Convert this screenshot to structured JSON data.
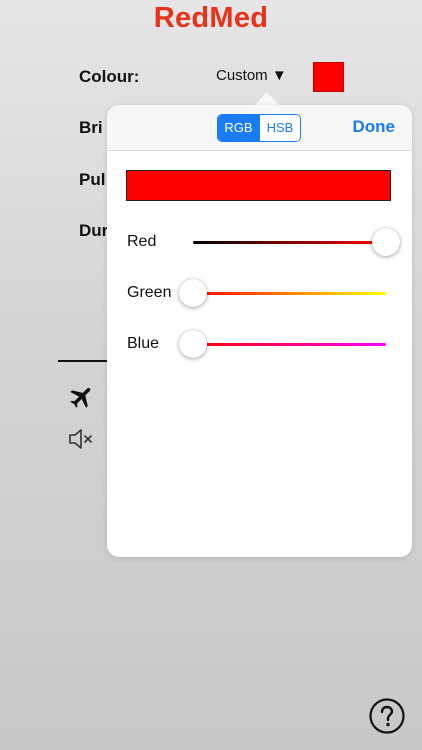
{
  "app": {
    "title": "RedMed",
    "accent_color": "#e8331a"
  },
  "settings": {
    "colour_label": "Colour:",
    "colour_value": "Custom ▼",
    "colour_swatch": "#ff0000",
    "rows_partial": [
      "Bri",
      "Pul",
      "Dur"
    ]
  },
  "icons": {
    "airplane": "airplane-icon",
    "mute": "speaker-muted-icon",
    "help": "question-mark-circle-icon"
  },
  "popover": {
    "tabs": [
      {
        "label": "RGB",
        "active": true
      },
      {
        "label": "HSB",
        "active": false
      }
    ],
    "done_label": "Done",
    "preview_color": "#ff0000",
    "sliders": [
      {
        "label": "Red",
        "value": 1.0
      },
      {
        "label": "Green",
        "value": 0.0
      },
      {
        "label": "Blue",
        "value": 0.0
      }
    ]
  }
}
